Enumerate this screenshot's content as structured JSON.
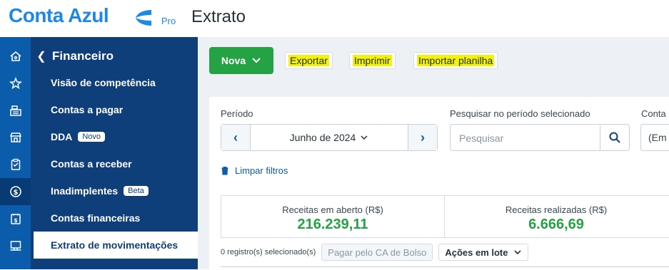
{
  "brand": {
    "name": "Conta Azul",
    "edition": "Pro",
    "color": "#1e88e5"
  },
  "page": {
    "title": "Extrato"
  },
  "rail": {
    "icons": [
      {
        "name": "home-icon"
      },
      {
        "name": "star-icon"
      },
      {
        "name": "cash-register-icon"
      },
      {
        "name": "store-icon"
      },
      {
        "name": "clipboard-icon"
      },
      {
        "name": "dollar-circle-icon",
        "active": true
      },
      {
        "name": "invoice-dollar-icon"
      },
      {
        "name": "monitor-icon"
      }
    ]
  },
  "sidebar": {
    "header": "Financeiro",
    "items": [
      {
        "label": "Visão de competência"
      },
      {
        "label": "Contas a pagar"
      },
      {
        "label": "DDA",
        "badge": "Novo"
      },
      {
        "label": "Contas a receber"
      },
      {
        "label": "Inadimplentes",
        "badge": "Beta"
      },
      {
        "label": "Contas financeiras"
      },
      {
        "label": "Extrato de movimentações",
        "active": true
      }
    ]
  },
  "toolbar": {
    "new_label": "Nova",
    "export_label": "Exportar",
    "print_label": "Imprimir",
    "import_label": "Importar planilha",
    "highlight_color": "#f2f20a",
    "primary_color": "#25a244"
  },
  "filters": {
    "period_label": "Período",
    "period_value": "Junho de 2024",
    "search_label": "Pesquisar no período selecionado",
    "search_placeholder": "Pesquisar",
    "account_label": "Conta",
    "account_value": "(Em",
    "clear_label": "Limpar filtros"
  },
  "stats": [
    {
      "title": "Receitas em aberto (R$)",
      "value": "216.239,11"
    },
    {
      "title": "Receitas realizadas (R$)",
      "value": "6.666,69"
    }
  ],
  "bulk": {
    "selected_text": "0 registro(s) selecionado(s)",
    "pay_label": "Pagar pelo CA de Bolso",
    "actions_label": "Ações em lote"
  }
}
